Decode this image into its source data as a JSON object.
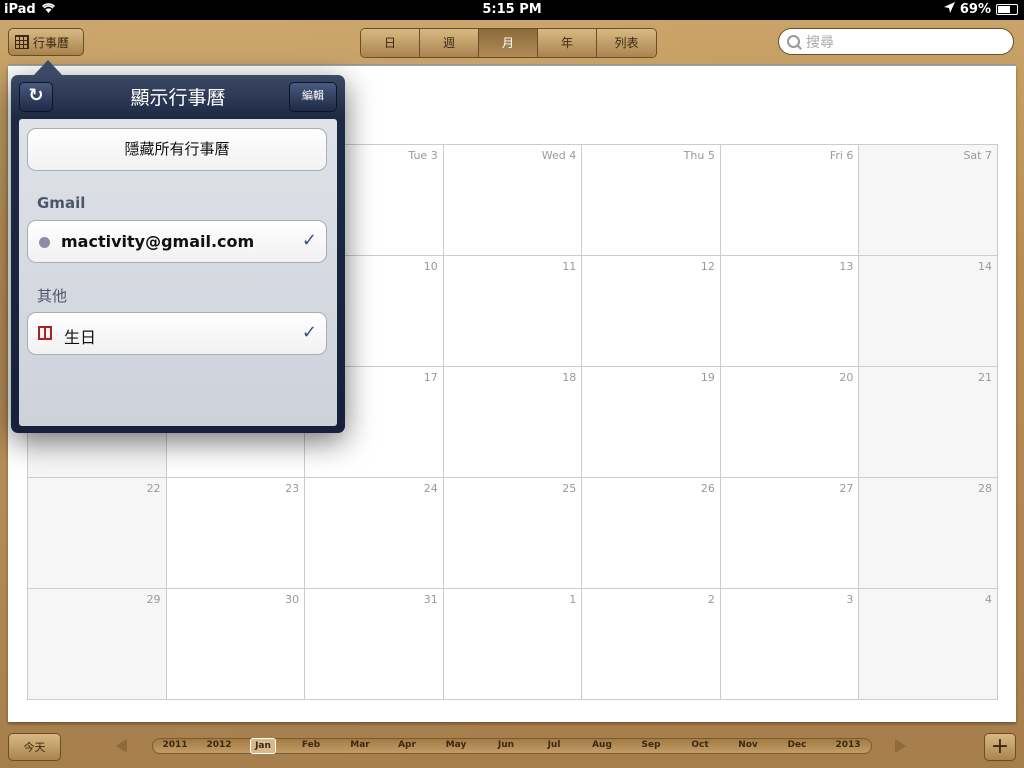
{
  "status": {
    "device": "iPad",
    "time": "5:15 PM",
    "battery": "69%"
  },
  "toolbar": {
    "calendars_label": "行事曆",
    "segments": [
      "日",
      "週",
      "月",
      "年",
      "列表"
    ],
    "selected_segment": "月",
    "search_placeholder": "搜尋"
  },
  "popover": {
    "title": "顯示行事曆",
    "edit_label": "編輯",
    "hide_all_label": "隱藏所有行事曆",
    "sections": [
      {
        "header": "Gmail",
        "item": "mactivity@gmail.com",
        "checked": true,
        "color": "#8a8ca8",
        "icon": "dot-icon"
      },
      {
        "header": "其他",
        "item": "生日",
        "checked": true,
        "color": "#b02020",
        "icon": "gift-icon"
      }
    ],
    "check_glyph": "✓",
    "refresh_glyph": "↻"
  },
  "calendar": {
    "weeks": [
      [
        "",
        "",
        "Tue 3",
        "Wed 4",
        "Thu 5",
        "Fri 6",
        "Sat 7"
      ],
      [
        "",
        "",
        "10",
        "11",
        "12",
        "13",
        "14"
      ],
      [
        "",
        "",
        "17",
        "18",
        "19",
        "20",
        "21"
      ],
      [
        "22",
        "23",
        "24",
        "25",
        "26",
        "27",
        "28"
      ],
      [
        "29",
        "30",
        "31",
        "1",
        "2",
        "3",
        "4"
      ]
    ]
  },
  "bottom": {
    "today_label": "今天",
    "add_label": "+",
    "timeline": [
      "2011",
      "2012",
      "Jan",
      "Feb",
      "Mar",
      "Apr",
      "May",
      "Jun",
      "Jul",
      "Aug",
      "Sep",
      "Oct",
      "Nov",
      "Dec",
      "2013"
    ],
    "selected": "Jan"
  }
}
